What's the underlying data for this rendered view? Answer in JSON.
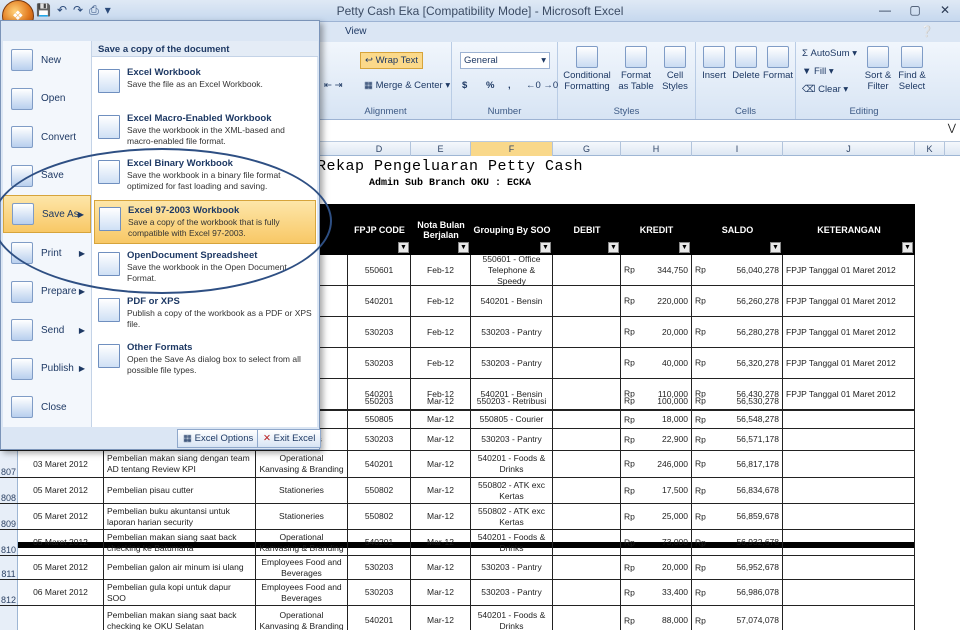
{
  "window": {
    "title": "Petty Cash Eka  [Compatibility Mode]  -  Microsoft Excel"
  },
  "ribbon": {
    "view_tab": "View",
    "wrap_text": "Wrap Text",
    "merge_center": "Merge & Center",
    "alignment_label": "Alignment",
    "number_format": "General",
    "currency": "$",
    "percent": "%",
    "comma": ",",
    "number_label": "Number",
    "conditional_formatting": "Conditional Formatting",
    "format_as_table": "Format as Table",
    "cell_styles": "Cell Styles",
    "styles_label": "Styles",
    "insert": "Insert",
    "delete": "Delete",
    "format": "Format",
    "cells_label": "Cells",
    "autosum": "AutoSum",
    "fill": "Fill",
    "clear": "Clear",
    "sort_filter": "Sort & Filter",
    "find_select": "Find & Select",
    "editing_label": "Editing"
  },
  "columns": [
    "D",
    "E",
    "F",
    "G",
    "H",
    "I",
    "J",
    "K"
  ],
  "sheet": {
    "title": "Rekap Pengeluaran Petty Cash",
    "subtitle": "Admin Sub Branch OKU : ECKA",
    "headers": {
      "fpjp": "FPJP CODE",
      "nota": "Nota Bulan Berjalan",
      "grouping": "Grouping By SOO",
      "debit": "DEBIT",
      "kredit": "KREDIT",
      "saldo": "SALDO",
      "keterangan": "KETERANGAN"
    },
    "rows_top": [
      {
        "frag": "one",
        "fpjp": "550601",
        "nota": "Feb-12",
        "group": "550601 - Office Telephone & Speedy",
        "rp1": "Rp",
        "kredit": "344,750",
        "rp2": "Rp",
        "saldo": "56,040,278",
        "ket": "FPJP Tanggal 01 Maret 2012"
      },
      {
        "frag": "vasing &",
        "fpjp": "540201",
        "nota": "Feb-12",
        "group": "540201 - Bensin",
        "rp1": "Rp",
        "kredit": "220,000",
        "rp2": "Rp",
        "saldo": "56,260,278",
        "ket": "FPJP Tanggal 01 Maret 2012"
      },
      {
        "frag": "od and",
        "fpjp": "530203",
        "nota": "Feb-12",
        "group": "530203 - Pantry",
        "rp1": "Rp",
        "kredit": "20,000",
        "rp2": "Rp",
        "saldo": "56,280,278",
        "ket": "FPJP Tanggal 01 Maret 2012"
      },
      {
        "frag": "od and",
        "fpjp": "530203",
        "nota": "Feb-12",
        "group": "530203 - Pantry",
        "rp1": "Rp",
        "kredit": "40,000",
        "rp2": "Rp",
        "saldo": "56,320,278",
        "ket": "FPJP Tanggal 01 Maret 2012"
      },
      {
        "frag": "vasing &",
        "fpjp": "540201",
        "nota": "Feb-12",
        "group": "540201 - Bensin",
        "rp1": "Rp",
        "kredit": "110,000",
        "rp2": "Rp",
        "saldo": "56,430,278",
        "ket": "FPJP Tanggal 01 Maret 2012"
      }
    ],
    "rows_bottom": [
      {
        "rn": "",
        "date": "",
        "desc": "",
        "cat": "ort",
        "fpjp": "550203",
        "nota": "Mar-12",
        "group": "550203 - Retribusi",
        "rp1": "Rp",
        "kredit": "100,000",
        "rp2": "Rp",
        "saldo": "56,530,278"
      },
      {
        "rn": "",
        "date": "",
        "desc": "",
        "cat": "",
        "fpjp": "550805",
        "nota": "Mar-12",
        "group": "550805 - Courier",
        "rp1": "Rp",
        "kredit": "18,000",
        "rp2": "Rp",
        "saldo": "56,548,278"
      },
      {
        "rn": "",
        "date": "",
        "desc": "",
        "cat": "Beverages",
        "fpjp": "530203",
        "nota": "Mar-12",
        "group": "530203 - Pantry",
        "rp1": "Rp",
        "kredit": "22,900",
        "rp2": "Rp",
        "saldo": "56,571,178"
      },
      {
        "rn": "807",
        "date": "03 Maret 2012",
        "desc": "Pembelian makan siang dengan team AD tentang Review KPI",
        "cat": "Operational Kanvasing & Branding",
        "fpjp": "540201",
        "nota": "Mar-12",
        "group": "540201 - Foods & Drinks",
        "rp1": "Rp",
        "kredit": "246,000",
        "rp2": "Rp",
        "saldo": "56,817,178"
      },
      {
        "rn": "808",
        "date": "05 Maret 2012",
        "desc": "Pembelian pisau cutter",
        "cat": "Stationeries",
        "fpjp": "550802",
        "nota": "Mar-12",
        "group": "550802 - ATK exc Kertas",
        "rp1": "Rp",
        "kredit": "17,500",
        "rp2": "Rp",
        "saldo": "56,834,678"
      },
      {
        "rn": "809",
        "date": "05 Maret 2012",
        "desc": "Pembelian buku akuntansi untuk laporan harian security",
        "cat": "Stationeries",
        "fpjp": "550802",
        "nota": "Mar-12",
        "group": "550802 - ATK exc Kertas",
        "rp1": "Rp",
        "kredit": "25,000",
        "rp2": "Rp",
        "saldo": "56,859,678"
      },
      {
        "rn": "810",
        "date": "05 Maret 2012",
        "desc": "Pembelian makan siang saat back checking ke Batumarta",
        "cat": "Operational Kanvasing & Branding",
        "fpjp": "540201",
        "nota": "Mar-12",
        "group": "540201 - Foods & Drinks",
        "rp1": "Rp",
        "kredit": "73,000",
        "rp2": "Rp",
        "saldo": "56,932,678"
      },
      {
        "rn": "811",
        "date": "05 Maret 2012",
        "desc": "Pembelian galon air minum isi ulang",
        "cat": "Employees Food and Beverages",
        "fpjp": "530203",
        "nota": "Mar-12",
        "group": "530203 - Pantry",
        "rp1": "Rp",
        "kredit": "20,000",
        "rp2": "Rp",
        "saldo": "56,952,678"
      },
      {
        "rn": "812",
        "date": "06 Maret 2012",
        "desc": "Pembelian gula kopi untuk dapur SOO",
        "cat": "Employees Food and Beverages",
        "fpjp": "530203",
        "nota": "Mar-12",
        "group": "530203 - Pantry",
        "rp1": "Rp",
        "kredit": "33,400",
        "rp2": "Rp",
        "saldo": "56,986,078"
      },
      {
        "rn": "",
        "date": "",
        "desc": "Pembelian makan siang saat back checking ke OKU Selatan",
        "cat": "Operational Kanvasing & Branding",
        "fpjp": "540201",
        "nota": "Mar-12",
        "group": "540201 - Foods & Drinks",
        "rp1": "Rp",
        "kredit": "88,000",
        "rp2": "Rp",
        "saldo": "57,074,078"
      }
    ]
  },
  "office_menu": {
    "items": [
      {
        "label": "New"
      },
      {
        "label": "Open"
      },
      {
        "label": "Convert"
      },
      {
        "label": "Save"
      },
      {
        "label": "Save As"
      },
      {
        "label": "Print"
      },
      {
        "label": "Prepare"
      },
      {
        "label": "Send"
      },
      {
        "label": "Publish"
      },
      {
        "label": "Close"
      }
    ],
    "submenu_title": "Save a copy of the document",
    "options": [
      {
        "title": "Excel Workbook",
        "desc": "Save the file as an Excel Workbook."
      },
      {
        "title": "Excel Macro-Enabled Workbook",
        "desc": "Save the workbook in the XML-based and macro-enabled file format."
      },
      {
        "title": "Excel Binary Workbook",
        "desc": "Save the workbook in a binary file format optimized for fast loading and saving."
      },
      {
        "title": "Excel 97-2003 Workbook",
        "desc": "Save a copy of the workbook that is fully compatible with Excel 97-2003."
      },
      {
        "title": "OpenDocument Spreadsheet",
        "desc": "Save the workbook in the Open Document Format."
      },
      {
        "title": "PDF or XPS",
        "desc": "Publish a copy of the workbook as a PDF or XPS file."
      },
      {
        "title": "Other Formats",
        "desc": "Open the Save As dialog box to select from all possible file types."
      }
    ],
    "excel_options": "Excel Options",
    "exit_excel": "Exit Excel"
  }
}
